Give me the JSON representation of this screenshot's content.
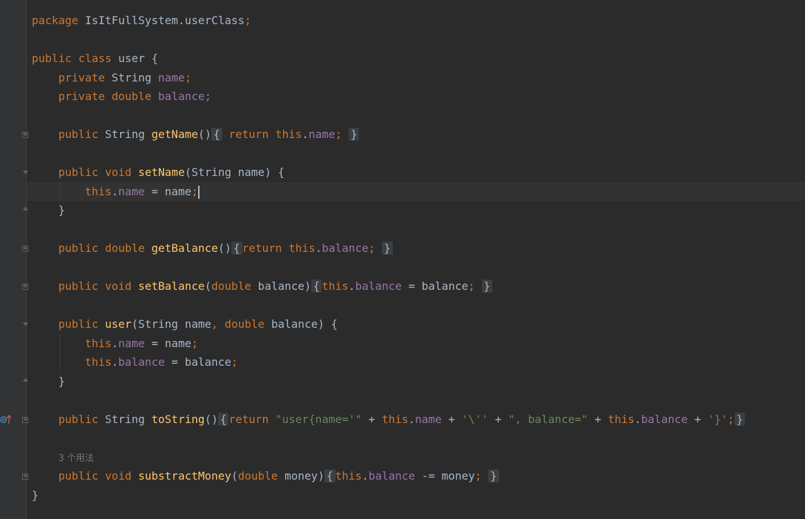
{
  "editor": {
    "lines": {
      "package_kw": "package",
      "package_name": " IsItFullSystem.userClass",
      "semicolon": ";",
      "public": "public",
      "class": "class",
      "private": "private",
      "void": "void",
      "double": "double",
      "string_type": "String",
      "return": "return",
      "this": "this",
      "class_name": "user",
      "field_name": "name",
      "field_balance": "balance",
      "getName": "getName",
      "setName": "setName",
      "getBalance": "getBalance",
      "setBalance": "setBalance",
      "constructor": "user",
      "toString": "toString",
      "substractMoney": "substractMoney",
      "param_name": "name",
      "param_balance": "balance",
      "param_money": "money",
      "str_user": "\"user{name='\"",
      "str_quote": "'\\''",
      "str_balance": "\", balance=\"",
      "str_close": "'}'"
    },
    "usage_hint": "3 个用法"
  },
  "colors": {
    "background": "#2b2b2b",
    "keyword": "#cc7832",
    "field": "#9876aa",
    "method": "#ffc66d",
    "string": "#6a8759",
    "text": "#a9b7c6"
  }
}
